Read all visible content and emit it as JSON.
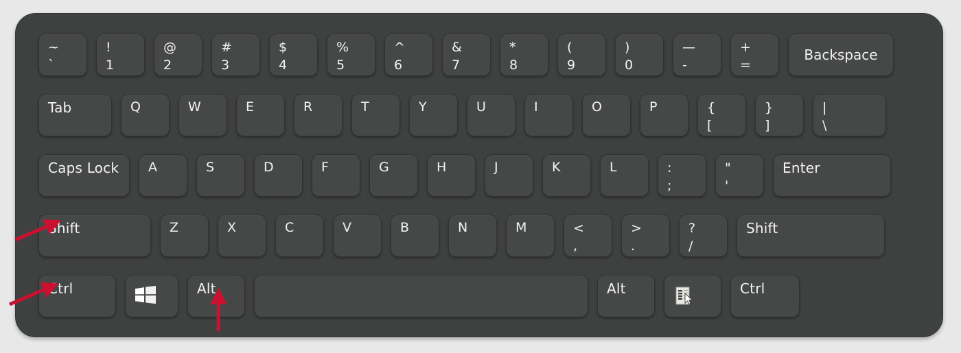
{
  "scene": {
    "subject": "computer-keyboard-diagram",
    "background_color": "#e8e8e8",
    "chassis_color": "#3f4140",
    "key_color": "#464847",
    "legend_color": "#f2f2f2",
    "arrow_color": "#cc1030"
  },
  "rows": {
    "number_row": [
      {
        "name": "backquote",
        "top": "~",
        "bottom": "`"
      },
      {
        "name": "one",
        "top": "!",
        "bottom": "1"
      },
      {
        "name": "two",
        "top": "@",
        "bottom": "2"
      },
      {
        "name": "three",
        "top": "#",
        "bottom": "3"
      },
      {
        "name": "four",
        "top": "$",
        "bottom": "4"
      },
      {
        "name": "five",
        "top": "%",
        "bottom": "5"
      },
      {
        "name": "six",
        "top": "^",
        "bottom": "6"
      },
      {
        "name": "seven",
        "top": "&",
        "bottom": "7"
      },
      {
        "name": "eight",
        "top": "*",
        "bottom": "8"
      },
      {
        "name": "nine",
        "top": "(",
        "bottom": "9"
      },
      {
        "name": "zero",
        "top": ")",
        "bottom": "0"
      },
      {
        "name": "minus",
        "top": "—",
        "bottom": "-"
      },
      {
        "name": "equal",
        "top": "+",
        "bottom": "="
      },
      {
        "name": "backspace",
        "label": "Backspace"
      }
    ],
    "tab_row": [
      {
        "name": "tab",
        "label": "Tab"
      },
      {
        "name": "q",
        "label": "Q"
      },
      {
        "name": "w",
        "label": "W"
      },
      {
        "name": "e",
        "label": "E"
      },
      {
        "name": "r",
        "label": "R"
      },
      {
        "name": "t",
        "label": "T"
      },
      {
        "name": "y",
        "label": "Y"
      },
      {
        "name": "u",
        "label": "U"
      },
      {
        "name": "i",
        "label": "I"
      },
      {
        "name": "o",
        "label": "O"
      },
      {
        "name": "p",
        "label": "P"
      },
      {
        "name": "bracket-left",
        "top": "{",
        "bottom": "["
      },
      {
        "name": "bracket-right",
        "top": "}",
        "bottom": "]"
      },
      {
        "name": "backslash",
        "top": "|",
        "bottom": "\\"
      }
    ],
    "caps_row": [
      {
        "name": "caps-lock",
        "label": "Caps Lock"
      },
      {
        "name": "a",
        "label": "A"
      },
      {
        "name": "s",
        "label": "S"
      },
      {
        "name": "d",
        "label": "D"
      },
      {
        "name": "f",
        "label": "F"
      },
      {
        "name": "g",
        "label": "G"
      },
      {
        "name": "h",
        "label": "H"
      },
      {
        "name": "j",
        "label": "J"
      },
      {
        "name": "k",
        "label": "K"
      },
      {
        "name": "l",
        "label": "L"
      },
      {
        "name": "semicolon",
        "top": ":",
        "bottom": ";"
      },
      {
        "name": "quote",
        "top": "\"",
        "bottom": "'"
      },
      {
        "name": "enter",
        "label": "Enter"
      }
    ],
    "shift_row": [
      {
        "name": "shift-left",
        "label": "Shift"
      },
      {
        "name": "z",
        "label": "Z"
      },
      {
        "name": "x",
        "label": "X"
      },
      {
        "name": "c",
        "label": "C"
      },
      {
        "name": "v",
        "label": "V"
      },
      {
        "name": "b",
        "label": "B"
      },
      {
        "name": "n",
        "label": "N"
      },
      {
        "name": "m",
        "label": "M"
      },
      {
        "name": "comma",
        "top": "<",
        "bottom": ","
      },
      {
        "name": "period",
        "top": ">",
        "bottom": "."
      },
      {
        "name": "slash",
        "top": "?",
        "bottom": "/"
      },
      {
        "name": "shift-right",
        "label": "Shift"
      }
    ],
    "ctrl_row": [
      {
        "name": "ctrl-left",
        "label": "Ctrl"
      },
      {
        "name": "windows",
        "icon": "windows-logo-icon"
      },
      {
        "name": "alt-left",
        "label": "Alt"
      },
      {
        "name": "space",
        "label": ""
      },
      {
        "name": "alt-right",
        "label": "Alt"
      },
      {
        "name": "menu",
        "icon": "context-menu-icon"
      },
      {
        "name": "ctrl-right",
        "label": "Ctrl"
      }
    ]
  },
  "annotations": [
    {
      "name": "arrow-to-shift",
      "target": "Shift",
      "direction": "up-right"
    },
    {
      "name": "arrow-to-ctrl",
      "target": "Ctrl",
      "direction": "up-right"
    },
    {
      "name": "arrow-to-alt",
      "target": "Alt",
      "direction": "up"
    }
  ]
}
